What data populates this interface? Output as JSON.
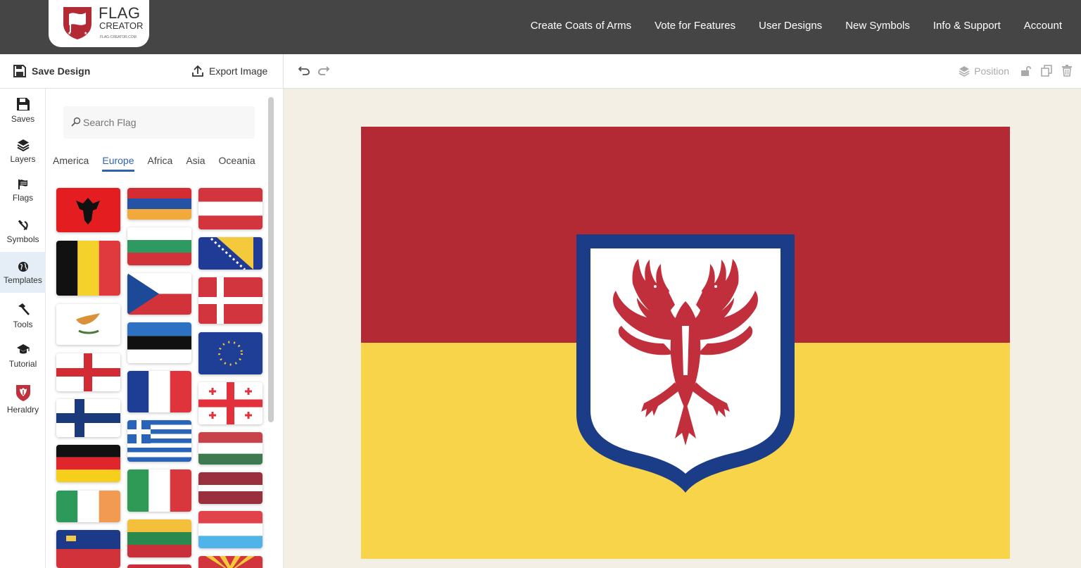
{
  "brand": {
    "name_line1": "FLAG",
    "name_line2": "CREATOR",
    "domain": "FLAG-CREATOR.COM",
    "colors": {
      "red": "#b32934",
      "yellow": "#f8d44a",
      "blue": "#1b3c87"
    }
  },
  "nav": {
    "items": [
      "Create Coats of Arms",
      "Vote for Features",
      "User Designs",
      "New Symbols",
      "Info & Support",
      "Account"
    ]
  },
  "toolbar": {
    "save_label": "Save Design",
    "export_label": "Export Image",
    "position_label": "Position",
    "icons": [
      "undo-icon",
      "redo-icon",
      "layers-icon",
      "lock-icon",
      "duplicate-icon",
      "trash-icon"
    ]
  },
  "sidenav": {
    "active": "Templates",
    "items": [
      {
        "label": "Saves",
        "icon": "save-icon"
      },
      {
        "label": "Layers",
        "icon": "layers-icon"
      },
      {
        "label": "Flags",
        "icon": "flag-icon"
      },
      {
        "label": "Symbols",
        "icon": "hammer-sickle-icon"
      },
      {
        "label": "Templates",
        "icon": "globe-icon"
      },
      {
        "label": "Tools",
        "icon": "hammer-icon"
      },
      {
        "label": "Tutorial",
        "icon": "graduation-cap-icon"
      },
      {
        "label": "Heraldry",
        "icon": "heraldry-shield-icon"
      }
    ]
  },
  "panel": {
    "search_placeholder": "Search Flag",
    "active_tab": "Europe",
    "tabs": [
      "America",
      "Europe",
      "Africa",
      "Asia",
      "Oceania"
    ]
  },
  "canvas": {
    "design": {
      "type": "horizontal-bicolor",
      "top_color": "#b32934",
      "bottom_color": "#f8d44a",
      "emblem": "double-headed-eagle-shield",
      "shield_border": "#1b3c87",
      "shield_fill": "#ffffff",
      "eagle_color": "#c12f3c"
    }
  }
}
